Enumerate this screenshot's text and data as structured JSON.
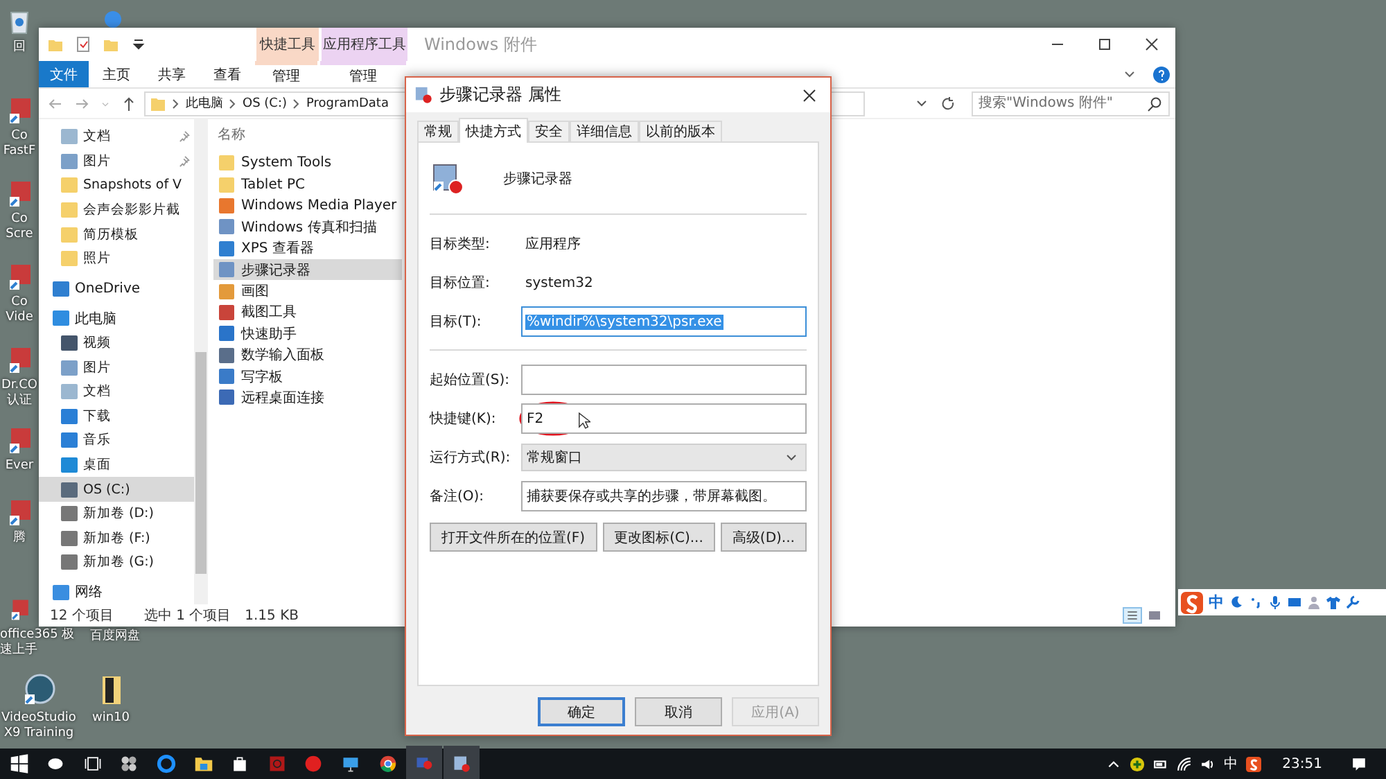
{
  "desktop_icons": [
    {
      "lines": [
        "回"
      ],
      "kind": "recycle"
    },
    {
      "lines": [
        "Co",
        "FastF"
      ],
      "kind": "app"
    },
    {
      "lines": [
        "Co",
        "Scre"
      ],
      "kind": "app"
    },
    {
      "lines": [
        "Co",
        "Vide"
      ],
      "kind": "app"
    },
    {
      "lines": [
        "Dr.CO",
        "认证"
      ],
      "kind": "app"
    },
    {
      "lines": [
        "Ever"
      ],
      "kind": "app"
    },
    {
      "lines": [
        "腾"
      ],
      "kind": "app"
    },
    {
      "lines": [
        "office365 极",
        "速上手"
      ],
      "kind": "app"
    },
    {
      "lines": [
        "百度网盘"
      ],
      "kind": "none"
    },
    {
      "lines": [
        "VideoStudio",
        "X9 Training"
      ],
      "kind": "sb"
    },
    {
      "lines": [
        "win10"
      ],
      "kind": "folder"
    }
  ],
  "explorer": {
    "title": "Windows 附件",
    "context_tabs": [
      {
        "label": "快捷工具",
        "color": "#f9d8c6"
      },
      {
        "label": "应用程序工具",
        "color": "#ecd3f2"
      }
    ],
    "ribbon_tabs": [
      {
        "label": "文件",
        "kind": "file"
      },
      {
        "label": "主页",
        "kind": "tab"
      },
      {
        "label": "共享",
        "kind": "tab"
      },
      {
        "label": "查看",
        "kind": "tab"
      },
      {
        "label": "管理",
        "kind": "context"
      },
      {
        "label": "管理",
        "kind": "context"
      }
    ],
    "breadcrumb": [
      "此电脑",
      "OS (C:)",
      "ProgramData"
    ],
    "search": {
      "placeholder": "搜索\"Windows 附件\""
    },
    "quick_access": [
      {
        "label": "文档",
        "kind": "doc",
        "pinned": true
      },
      {
        "label": "图片",
        "kind": "pic",
        "pinned": true
      },
      {
        "label": "Snapshots of V",
        "kind": "folder",
        "pinned": false
      },
      {
        "label": "会声会影影片截",
        "kind": "folder",
        "pinned": false
      },
      {
        "label": "简历模板",
        "kind": "folder",
        "pinned": false
      },
      {
        "label": "照片",
        "kind": "folder",
        "pinned": false
      }
    ],
    "nav_tree": [
      {
        "label": "OneDrive",
        "kind": "cloud",
        "selected": false
      },
      {
        "label": "此电脑",
        "kind": "pc",
        "selected": false,
        "children": [
          {
            "label": "视频",
            "kind": "video",
            "selected": false
          },
          {
            "label": "图片",
            "kind": "pic",
            "selected": false
          },
          {
            "label": "文档",
            "kind": "doc",
            "selected": false
          },
          {
            "label": "下载",
            "kind": "download",
            "selected": false
          },
          {
            "label": "音乐",
            "kind": "music",
            "selected": false
          },
          {
            "label": "桌面",
            "kind": "desktop",
            "selected": false
          },
          {
            "label": "OS (C:)",
            "kind": "osdrive",
            "selected": true
          },
          {
            "label": "新加卷 (D:)",
            "kind": "drive",
            "selected": false
          },
          {
            "label": "新加卷 (F:)",
            "kind": "drive",
            "selected": false
          },
          {
            "label": "新加卷 (G:)",
            "kind": "drive",
            "selected": false
          }
        ]
      },
      {
        "label": "网络",
        "kind": "network",
        "selected": false
      }
    ],
    "column_header": "名称",
    "files": [
      {
        "name": "System Tools",
        "kind": "folder",
        "selected": false
      },
      {
        "name": "Tablet PC",
        "kind": "folder",
        "selected": false
      },
      {
        "name": "Windows Media Player",
        "kind": "media",
        "selected": false
      },
      {
        "name": "Windows 传真和扫描",
        "kind": "fax",
        "selected": false
      },
      {
        "name": "XPS 查看器",
        "kind": "xps",
        "selected": false
      },
      {
        "name": "步骤记录器",
        "kind": "psr",
        "selected": true
      },
      {
        "name": "画图",
        "kind": "paint",
        "selected": false
      },
      {
        "name": "截图工具",
        "kind": "snip",
        "selected": false
      },
      {
        "name": "快速助手",
        "kind": "assist",
        "selected": false
      },
      {
        "name": "数学输入面板",
        "kind": "math",
        "selected": false
      },
      {
        "name": "写字板",
        "kind": "wordpad",
        "selected": false
      },
      {
        "name": "远程桌面连接",
        "kind": "remote",
        "selected": false
      }
    ],
    "status": {
      "count": "12 个项目",
      "selection": "选中 1 个项目",
      "size": "1.15 KB"
    }
  },
  "dialog": {
    "title": "步骤记录器 属性",
    "tabs": [
      {
        "label": "常规",
        "selected": false
      },
      {
        "label": "快捷方式",
        "selected": true
      },
      {
        "label": "安全",
        "selected": false
      },
      {
        "label": "详细信息",
        "selected": false
      },
      {
        "label": "以前的版本",
        "selected": false
      }
    ],
    "app_name": "步骤记录器",
    "fields": [
      {
        "kind": "text",
        "label": "目标类型:",
        "value": "应用程序"
      },
      {
        "kind": "text",
        "label": "目标位置:",
        "value": "system32"
      },
      {
        "kind": "input",
        "label": "目标(T):",
        "value": "%windir%\\system32\\psr.exe",
        "selected": true,
        "circled": false
      },
      {
        "kind": "divider"
      },
      {
        "kind": "input",
        "label": "起始位置(S):",
        "selected": false,
        "circled": false
      },
      {
        "kind": "input",
        "label": "快捷键(K):",
        "value": "F2",
        "selected": false,
        "circled": true
      },
      {
        "kind": "select",
        "label": "运行方式(R):",
        "value": "常规窗口"
      },
      {
        "kind": "input",
        "label": "备注(O):",
        "value": "捕获要保存或共享的步骤，带屏幕截图。",
        "selected": false,
        "circled": false
      }
    ],
    "actions": [
      "打开文件所在的位置(F)",
      "更改图标(C)...",
      "高级(D)..."
    ],
    "buttons": [
      {
        "label": "确定",
        "kind": "default",
        "disabled": false
      },
      {
        "label": "取消",
        "kind": "normal",
        "disabled": false
      },
      {
        "label": "应用(A)",
        "kind": "normal",
        "disabled": true
      }
    ]
  },
  "ime_bar": {
    "mode": "中"
  },
  "taskbar": {
    "ime": "中",
    "time": "23:51"
  }
}
